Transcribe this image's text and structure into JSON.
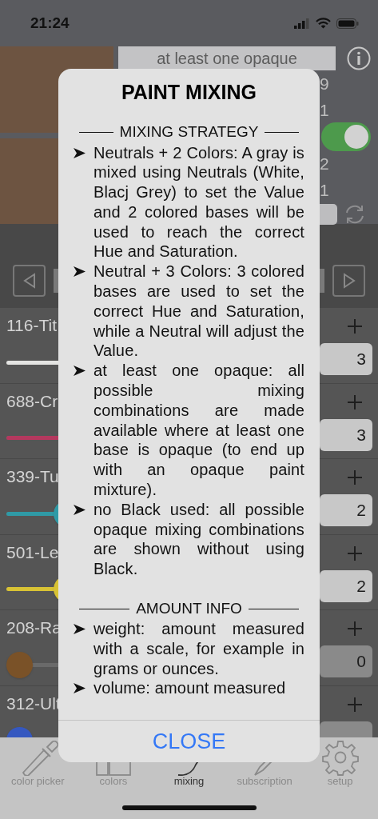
{
  "status_bar": {
    "time": "21:24"
  },
  "mixing_panel": {
    "strategy": "at least one opaque",
    "settings": [
      {
        "kind": "number",
        "text": "9"
      },
      {
        "kind": "number",
        "text": "1"
      },
      {
        "kind": "toggle",
        "on": true
      },
      {
        "kind": "number",
        "text": "2"
      },
      {
        "kind": "number",
        "text": "1"
      }
    ]
  },
  "colors": [
    {
      "name": "116-Tit",
      "color": "#e4e4e2",
      "level": 0.4,
      "amount": "3"
    },
    {
      "name": "688-Cr",
      "color": "#b4385e",
      "level": 0.4,
      "amount": "3"
    },
    {
      "name": "339-Tu",
      "color": "#2f9aa6",
      "level": 0.17,
      "amount": "2"
    },
    {
      "name": "501-Le",
      "color": "#d8c234",
      "level": 0.17,
      "amount": "2"
    },
    {
      "name": "208-Ra",
      "color": "#7a5228",
      "level": 0,
      "amount": "0"
    },
    {
      "name": "312-Ult",
      "color": "#3558c0",
      "level": 0
    }
  ],
  "tabs": [
    {
      "label": "color picker",
      "selected": false
    },
    {
      "label": "colors",
      "selected": false
    },
    {
      "label": "mixing",
      "selected": true
    },
    {
      "label": "subscription",
      "selected": false
    },
    {
      "label": "setup",
      "selected": false
    }
  ],
  "dialog": {
    "title": "PAINT MIXING",
    "sections": [
      {
        "heading": "MIXING STRATEGY",
        "items": [
          "Neutrals + 2 Colors: A gray is mixed using Neutrals (White, Blacj Grey) to set the Value and 2 colored bases will be used to reach the correct Hue and Saturation.",
          "Neutral + 3 Colors: 3 colored bases are used to set the correct Hue and Saturation, while a Neutral will adjust the Value.",
          "at least one opaque: all possible mixing combinations are made available where at least one base is opaque (to end up with an opaque paint mixture).",
          "no Black used: all possible opaque mixing combinations are shown without using Black."
        ]
      },
      {
        "heading": "AMOUNT INFO",
        "items": [
          "weight: amount measured with a scale, for example in grams or ounces.",
          "volume: amount measured"
        ]
      }
    ],
    "button": "CLOSE"
  }
}
